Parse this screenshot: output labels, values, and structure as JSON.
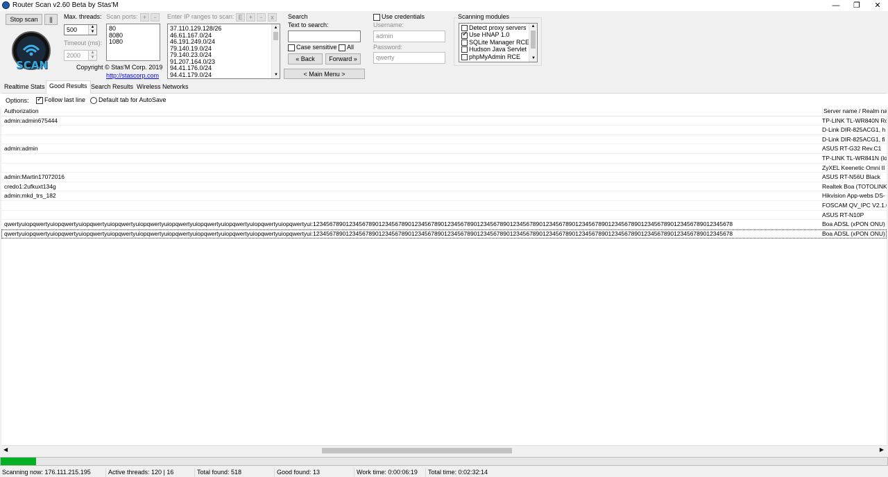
{
  "window": {
    "title": "Router Scan v2.60 Beta by Stas'M"
  },
  "controls": {
    "stop_scan": "Stop scan",
    "pause": "||",
    "max_threads_label": "Max. threads:",
    "max_threads_value": "500",
    "timeout_label": "Timeout (ms):",
    "timeout_value": "2000",
    "scan_ports_label": "Scan ports:",
    "ports": [
      "80",
      "8080",
      "1080"
    ],
    "ip_ranges_label": "Enter IP ranges to scan:",
    "ip_ranges": [
      "37.110.129.128/26",
      "46.61.167.0/24",
      "46.191.249.0/24",
      "79.140.19.0/24",
      "79.140.23.0/24",
      "91.207.164.0/23",
      "94.41.176.0/24",
      "94.41.179.0/24"
    ],
    "copyright": "Copyright © Stas'M Corp. 2019",
    "link": "http://stascorp.com",
    "logo_text": "SCAN",
    "mini_plus": "+",
    "mini_minus": "-",
    "mini_e": "E",
    "mini_x": "x"
  },
  "search": {
    "group_label": "Search",
    "text_label": "Text to search:",
    "text_value": "",
    "case_sensitive": "Case sensitive",
    "all": "All",
    "back": "« Back",
    "forward": "Forward »",
    "main_menu": "< Main Menu >"
  },
  "credentials": {
    "label": "Use credentials",
    "username_label": "Username:",
    "username_value": "admin",
    "password_label": "Password:",
    "password_value": "qwerty"
  },
  "modules": {
    "label": "Scanning modules",
    "items": [
      {
        "label": "Detect proxy servers",
        "checked": false
      },
      {
        "label": "Use HNAP 1.0",
        "checked": true
      },
      {
        "label": "SQLite Manager RCE",
        "checked": false
      },
      {
        "label": "Hudson Java Servlet",
        "checked": false
      },
      {
        "label": "phpMyAdmin RCE",
        "checked": false
      }
    ]
  },
  "tabs": [
    "Realtime Stats",
    "Good Results",
    "Search Results",
    "Wireless Networks"
  ],
  "options": {
    "label": "Options:",
    "follow_last_line": "Follow last line",
    "default_tab": "Default tab for AutoSave"
  },
  "table": {
    "columns": [
      "Authorization",
      "Server name / Realm na"
    ],
    "rows": [
      [
        "admin:admin675444",
        "TP-LINK TL-WR840N Rc"
      ],
      [
        "",
        "D-Link DIR-825ACG1, h"
      ],
      [
        "",
        "D-Link DIR-825ACG1, fi"
      ],
      [
        "admin:admin",
        "ASUS RT-G32 Rev.C1"
      ],
      [
        "",
        "TP-LINK TL-WR841N (lo"
      ],
      [
        "",
        "ZyXEL Keenetic Omni II"
      ],
      [
        "admin:Martin17072016",
        "ASUS RT-N56U Black"
      ],
      [
        "credo1:2ufkuxt134g",
        "Realtek Boa (TOTOLINK"
      ],
      [
        "admin:mkd_trs_182",
        "Hikvision App-webs DS-"
      ],
      [
        "",
        "FOSCAM QV_IPC V2.1.0"
      ],
      [
        "",
        "ASUS RT-N10P"
      ],
      [
        "qwertyuiopqwertyuiopqwertyuiopqwertyuiopqwertyuiopqwertyuiopqwertyuiopqwertyuiopqwertyuiopqwertyuiopqwertyui:12345678901234567890123456789012345678901234567890123456789012345678901234567890123456789012345678901234567890123456789012345678",
        "Boa ADSL (xPON ONU)"
      ],
      [
        "qwertyuiopqwertyuiopqwertyuiopqwertyuiopqwertyuiopqwertyuiopqwertyuiopqwertyuiopqwertyuiopqwertyuiopqwertyui:12345678901234567890123456789012345678901234567890123456789012345678901234567890123456789012345678901234567890123456789012345678",
        "Boa ADSL (xPON ONU)"
      ]
    ]
  },
  "progress": {
    "fraction": 0.04
  },
  "status": {
    "scanning_now": "Scanning now: 176.111.215.195",
    "active_threads": "Active threads: 120 | 16",
    "total_found": "Total found: 518",
    "good_found": "Good found: 13",
    "work_time": "Work time: 0:00:06:19",
    "total_time": "Total time: 0:02:32:14"
  },
  "colors": {
    "progress": "#06b025",
    "link": "#0000ee",
    "logo_ring": "#0a0a0a",
    "logo_text": "#39a6d8"
  }
}
